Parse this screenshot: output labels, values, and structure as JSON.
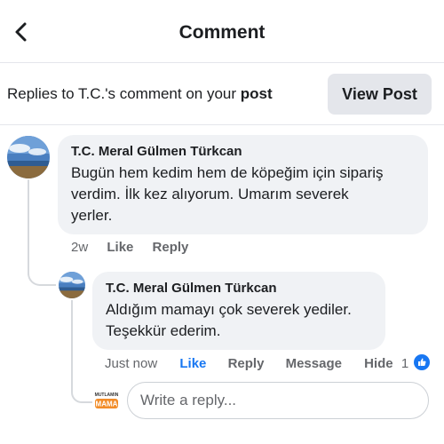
{
  "header": {
    "title": "Comment"
  },
  "context": {
    "text_prefix": "Replies to T.C.'s comment on your ",
    "text_bold": "post",
    "view_post_label": "View Post"
  },
  "comment": {
    "author": "T.C. Meral Gülmen Türkcan",
    "lines": [
      "Bugün hem kedim hem de köpeğim için sipariş",
      "verdim. İlk kez alıyorum. Umarım severek",
      "yerler."
    ],
    "time": "2w",
    "like_label": "Like",
    "reply_label": "Reply"
  },
  "reply": {
    "author": "T.C. Meral Gülmen Türkcan",
    "lines": [
      "Aldığım mamayı çok severek yediler.",
      "Teşekkür ederim."
    ],
    "time": "Just now",
    "like_label": "Like",
    "reply_label": "Reply",
    "message_label": "Message",
    "hide_label": "Hide",
    "reaction_count": "1"
  },
  "composer": {
    "placeholder": "Write a reply...",
    "logo_text_top": "MUTLAMIN",
    "logo_text_main": "MAMA"
  },
  "colors": {
    "accent": "#1877f2",
    "bubble": "#f0f2f5",
    "muted": "#65676b",
    "button_bg": "#e4e6eb"
  }
}
